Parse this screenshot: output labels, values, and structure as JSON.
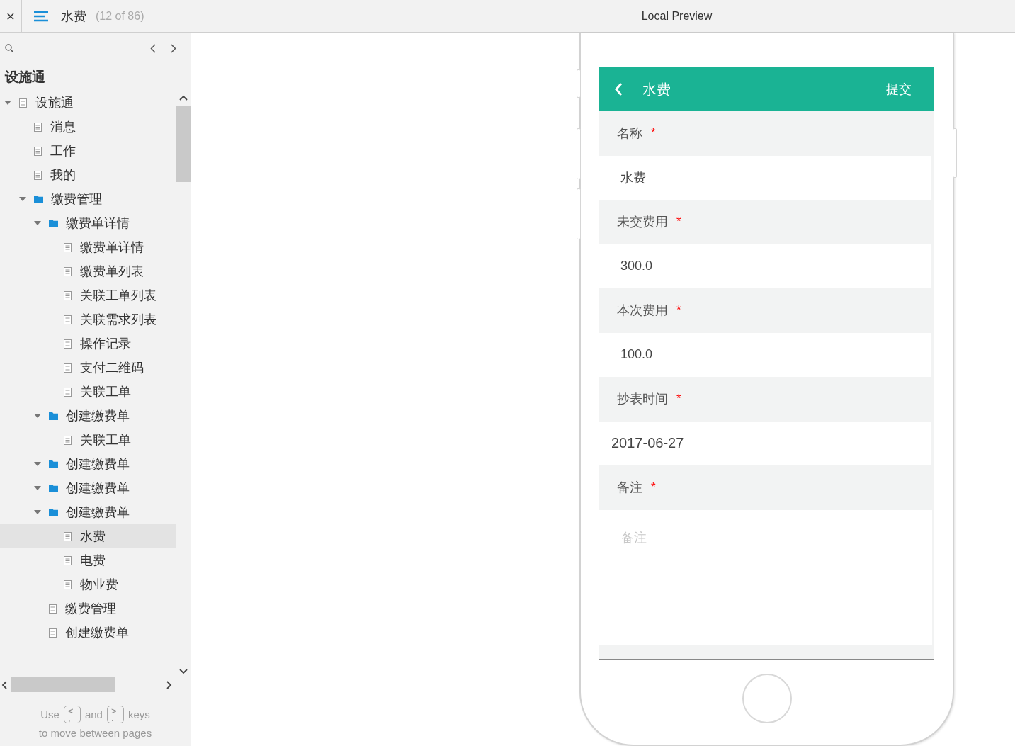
{
  "header": {
    "close": "×",
    "title": "水费",
    "count": "(12 of 86)",
    "preview_title": "Local Preview"
  },
  "sidebar": {
    "heading": "设施通",
    "tree": [
      {
        "label": "设施通",
        "kind": "page",
        "selected": false,
        "expanded": true,
        "children": [
          {
            "label": "消息",
            "kind": "page",
            "selected": false
          },
          {
            "label": "工作",
            "kind": "page",
            "selected": false
          },
          {
            "label": "我的",
            "kind": "page",
            "selected": false
          },
          {
            "label": "缴费管理",
            "kind": "folder",
            "selected": false,
            "expanded": true,
            "children": [
              {
                "label": "缴费单详情",
                "kind": "folder",
                "selected": false,
                "expanded": true,
                "children": [
                  {
                    "label": "缴费单详情",
                    "kind": "page",
                    "selected": false
                  },
                  {
                    "label": "缴费单列表",
                    "kind": "page",
                    "selected": false
                  },
                  {
                    "label": "关联工单列表",
                    "kind": "page",
                    "selected": false
                  },
                  {
                    "label": "关联需求列表",
                    "kind": "page",
                    "selected": false
                  },
                  {
                    "label": "操作记录",
                    "kind": "page",
                    "selected": false
                  },
                  {
                    "label": "支付二维码",
                    "kind": "page",
                    "selected": false
                  },
                  {
                    "label": "关联工单",
                    "kind": "page",
                    "selected": false
                  }
                ]
              },
              {
                "label": "创建缴费单",
                "kind": "folder",
                "selected": false,
                "expanded": true,
                "children": [
                  {
                    "label": "关联工单",
                    "kind": "page",
                    "selected": false
                  }
                ]
              },
              {
                "label": "创建缴费单",
                "kind": "folder",
                "selected": false,
                "expanded": true
              },
              {
                "label": "创建缴费单",
                "kind": "folder",
                "selected": false,
                "expanded": true
              },
              {
                "label": "创建缴费单",
                "kind": "folder",
                "selected": false,
                "expanded": true,
                "children": [
                  {
                    "label": "水费",
                    "kind": "page",
                    "selected": true
                  },
                  {
                    "label": "电费",
                    "kind": "page",
                    "selected": false
                  },
                  {
                    "label": "物业费",
                    "kind": "page",
                    "selected": false
                  }
                ]
              },
              {
                "label": "缴费管理",
                "kind": "page",
                "selected": false
              },
              {
                "label": "创建缴费单",
                "kind": "page",
                "selected": false
              }
            ]
          }
        ]
      }
    ]
  },
  "key_hint": {
    "before": "Use",
    "keys": [
      {
        "upper": "<",
        "lower": ","
      },
      {
        "upper": ">",
        "lower": "."
      }
    ],
    "between": "and",
    "after": "keys",
    "line_2": "to move between pages"
  },
  "phone": {
    "nav": {
      "title": "水费",
      "action": "提交"
    },
    "fields": [
      {
        "kind": "input",
        "label": "名称",
        "required_mark": "*",
        "value": "水费"
      },
      {
        "kind": "input",
        "label": "未交费用",
        "required_mark": "*",
        "value": "300.0"
      },
      {
        "kind": "input",
        "label": "本次费用",
        "required_mark": "*",
        "value": "100.0"
      },
      {
        "kind": "date",
        "label": "抄表时间",
        "required_mark": "*",
        "value": "2017-06-27"
      },
      {
        "kind": "textarea",
        "label": "备注",
        "required_mark": "*",
        "placeholder": "备注"
      }
    ]
  }
}
